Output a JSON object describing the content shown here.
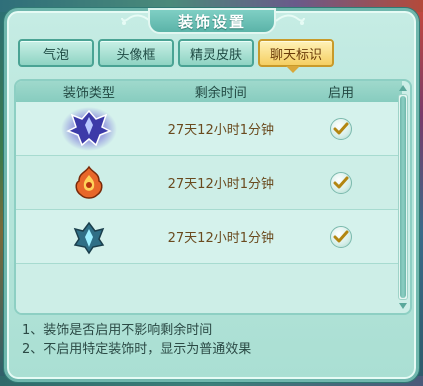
{
  "window": {
    "title": "装饰设置"
  },
  "tabs": [
    {
      "label": "气泡",
      "active": false
    },
    {
      "label": "头像框",
      "active": false
    },
    {
      "label": "精灵皮肤",
      "active": false
    },
    {
      "label": "聊天标识",
      "active": true
    }
  ],
  "table": {
    "headers": {
      "type": "装饰类型",
      "remaining": "剩余时间",
      "enabled": "启用"
    },
    "rows": [
      {
        "icon": "purple-dragon-emblem-icon",
        "remaining": "27天12小时1分钟",
        "enabled": true
      },
      {
        "icon": "orange-flame-emblem-icon",
        "remaining": "27天12小时1分钟",
        "enabled": true
      },
      {
        "icon": "cyan-crystal-emblem-icon",
        "remaining": "27天12小时1分钟",
        "enabled": true
      }
    ]
  },
  "notes": [
    "1、装饰是否启用不影响剩余时间",
    "2、不启用特定装饰时，显示为普通效果"
  ],
  "colors": {
    "panel_bg": "#b8e6dc",
    "active_tab": "#f5cf62",
    "time_text": "#6a4a1e"
  }
}
